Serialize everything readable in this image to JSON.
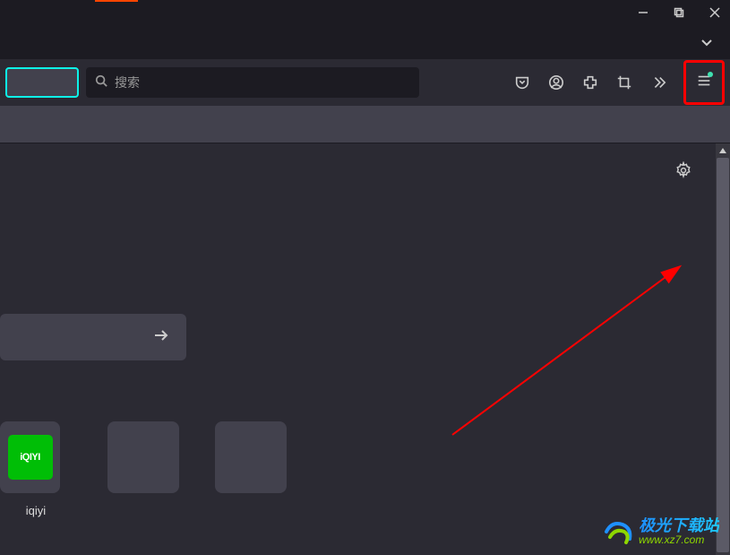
{
  "window": {
    "minimize": "minimize",
    "maximize": "maximize",
    "close": "close"
  },
  "toolbar": {
    "search_placeholder": "搜索",
    "icons": {
      "pocket": "pocket-icon",
      "account": "account-icon",
      "extension": "extension-icon",
      "crop": "crop-icon",
      "overflow": "overflow-icon",
      "menu": "menu-icon"
    }
  },
  "content": {
    "gear": "settings",
    "center_search_go": "go"
  },
  "tiles": [
    {
      "label": "iqiyi",
      "logo_text": "iQIYI"
    },
    {
      "label": ""
    },
    {
      "label": ""
    }
  ],
  "watermark": {
    "title": "极光下载站",
    "url": "www.xz7.com"
  },
  "colors": {
    "highlight": "#ff0000",
    "accent": "#0df2e8",
    "iqiyi": "#00be06"
  }
}
